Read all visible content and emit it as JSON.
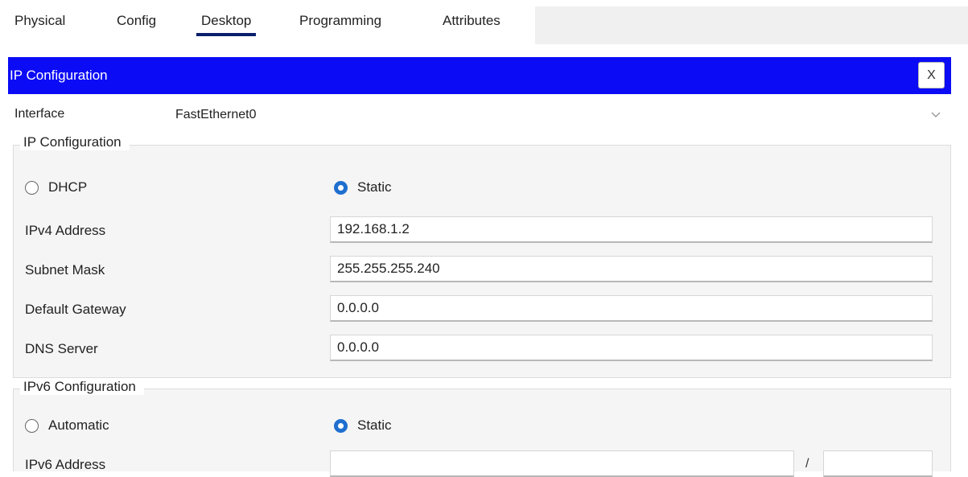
{
  "tabs": [
    {
      "label": "Physical"
    },
    {
      "label": "Config"
    },
    {
      "label": "Desktop"
    },
    {
      "label": "Programming"
    },
    {
      "label": "Attributes"
    }
  ],
  "active_tab": "Desktop",
  "window": {
    "title": "IP Configuration",
    "close_label": "X"
  },
  "interface": {
    "label": "Interface",
    "value": "FastEthernet0"
  },
  "ipv4": {
    "group_title": "IP Configuration",
    "dhcp_label": "DHCP",
    "static_label": "Static",
    "selected": "Static",
    "fields": [
      {
        "label": "IPv4 Address",
        "value": "192.168.1.2"
      },
      {
        "label": "Subnet Mask",
        "value": "255.255.255.240"
      },
      {
        "label": "Default Gateway",
        "value": "0.0.0.0"
      },
      {
        "label": "DNS Server",
        "value": "0.0.0.0"
      }
    ]
  },
  "ipv6": {
    "group_title": "IPv6 Configuration",
    "auto_label": "Automatic",
    "static_label": "Static",
    "selected": "Static",
    "address_label": "IPv6 Address",
    "address_value": "",
    "prefix_separator": "/",
    "prefix_value": ""
  },
  "colors": {
    "titlebar": "#0b0bf5",
    "radio_selected": "#1f6fcf",
    "tab_underline": "#0a1f6b"
  }
}
